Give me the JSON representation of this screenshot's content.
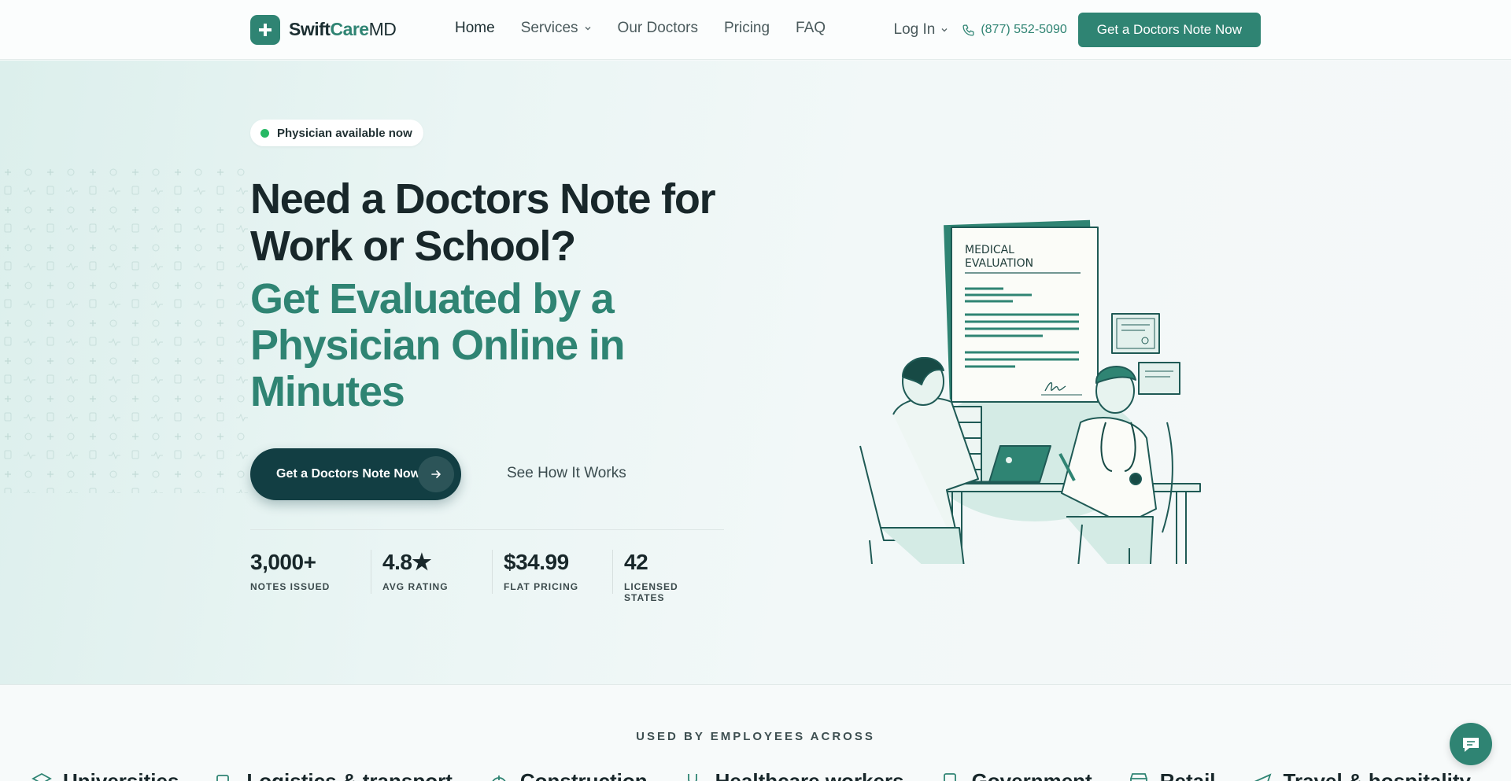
{
  "brand": {
    "name_part1": "Swift",
    "name_part2": "Care",
    "name_part3": "MD",
    "icon": "plus-icon",
    "accent_color": "#2f8473"
  },
  "nav": {
    "links": [
      {
        "label": "Home",
        "active": true
      },
      {
        "label": "Services",
        "has_dropdown": true
      },
      {
        "label": "Our Doctors"
      },
      {
        "label": "Pricing"
      },
      {
        "label": "FAQ"
      }
    ],
    "login_label": "Log In",
    "phone": "(877) 552-5090",
    "cta_label": "Get a Doctors Note Now"
  },
  "hero": {
    "badge": "Physician available now",
    "headline": "Need a Doctors Note for Work or School?",
    "subheadline": "Get Evaluated by a Physician Online in Minutes",
    "cta_label": "Get a Doctors Note Now",
    "secondary_cta": "See How It Works",
    "stats": [
      {
        "value": "3,000+",
        "label": "NOTES ISSUED"
      },
      {
        "value": "4.8★",
        "label": "AVG RATING"
      },
      {
        "value": "$34.99",
        "label": "FLAT PRICING"
      },
      {
        "value": "42",
        "label": "LICENSED STATES"
      }
    ],
    "illustration": {
      "doc_title_line1": "MEDICAL",
      "doc_title_line2": "EVALUATION"
    }
  },
  "used_by": {
    "title": "USED BY EMPLOYEES ACROSS",
    "industries": [
      {
        "label": "Universities",
        "icon": "graduation-cap-icon"
      },
      {
        "label": "Logistics & transport",
        "icon": "truck-icon"
      },
      {
        "label": "Construction",
        "icon": "hard-hat-icon"
      },
      {
        "label": "Healthcare workers",
        "icon": "stethoscope-icon"
      },
      {
        "label": "Government",
        "icon": "clipboard-icon"
      },
      {
        "label": "Retail",
        "icon": "storefront-icon"
      },
      {
        "label": "Travel & hospitality",
        "icon": "plane-icon"
      }
    ]
  },
  "chat": {
    "icon": "chat-icon"
  }
}
